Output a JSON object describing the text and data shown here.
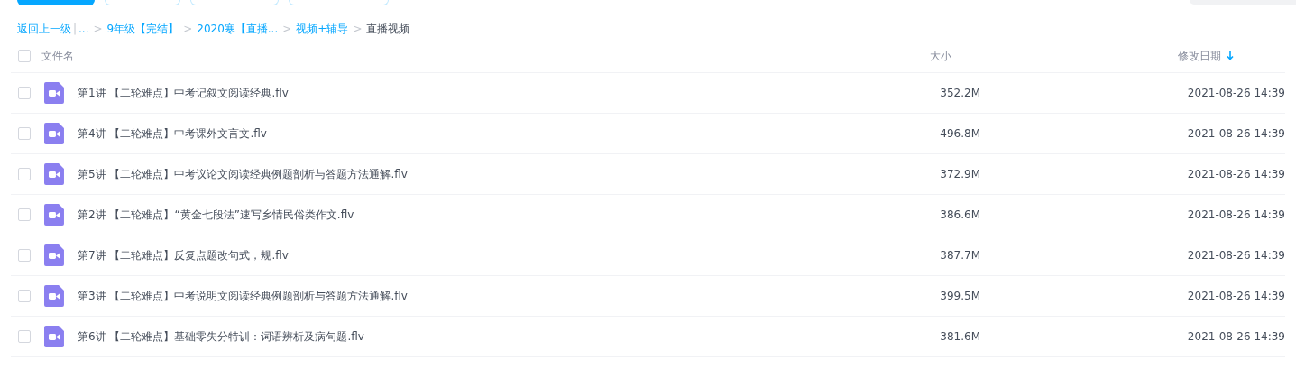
{
  "toolbar": {
    "buttons": [
      {
        "kind": "primary"
      },
      {
        "kind": "outline"
      },
      {
        "kind": "outline"
      },
      {
        "kind": "outline"
      }
    ]
  },
  "breadcrumb": [
    {
      "text": "返回上一级",
      "kind": "link"
    },
    {
      "text": "|",
      "kind": "bar"
    },
    {
      "text": "...",
      "kind": "link"
    },
    {
      "text": ">",
      "kind": "sep"
    },
    {
      "text": "9年级【完结】",
      "kind": "link"
    },
    {
      "text": ">",
      "kind": "sep"
    },
    {
      "text": "2020寒【直播...",
      "kind": "link"
    },
    {
      "text": ">",
      "kind": "sep"
    },
    {
      "text": "视频+辅导",
      "kind": "link"
    },
    {
      "text": ">",
      "kind": "sep"
    },
    {
      "text": "直播视频",
      "kind": "current"
    }
  ],
  "table": {
    "select_all": {
      "checked": false
    },
    "columns": [
      "文件名",
      "大小",
      "修改日期"
    ],
    "rows": [
      {
        "checked": false,
        "name": "第1讲 【二轮难点】中考记叙文阅读经典.flv",
        "size": "352.2M",
        "date": "2021-08-26 14:39"
      },
      {
        "checked": false,
        "name": "第4讲 【二轮难点】中考课外文言文.flv",
        "size": "496.8M",
        "date": "2021-08-26 14:39"
      },
      {
        "checked": false,
        "name": "第5讲 【二轮难点】中考议论文阅读经典例题剖析与答题方法通解.flv",
        "size": "372.9M",
        "date": "2021-08-26 14:39"
      },
      {
        "checked": false,
        "name": "第2讲 【二轮难点】“黄金七段法”速写乡情民俗类作文.flv",
        "size": "386.6M",
        "date": "2021-08-26 14:39"
      },
      {
        "checked": false,
        "name": "第7讲 【二轮难点】反复点题改句式，规.flv",
        "size": "387.7M",
        "date": "2021-08-26 14:39"
      },
      {
        "checked": false,
        "name": "第3讲 【二轮难点】中考说明文阅读经典例题剖析与答题方法通解.flv",
        "size": "399.5M",
        "date": "2021-08-26 14:39"
      },
      {
        "checked": false,
        "name": "第6讲 【二轮难点】基础零失分特训：词语辨析及病句题.flv",
        "size": "381.6M",
        "date": "2021-08-26 14:39"
      }
    ]
  }
}
